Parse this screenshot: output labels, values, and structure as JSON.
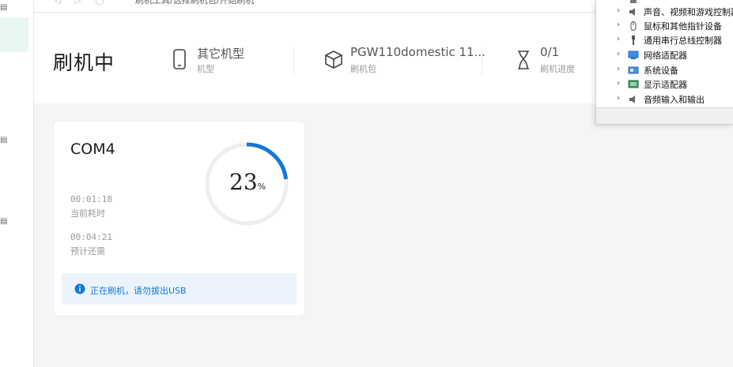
{
  "window": {
    "breadcrumb": "刷机工具/选择刷机包/开始刷机"
  },
  "header": {
    "title": "刷机中",
    "model": {
      "value": "其它机型",
      "label": "机型"
    },
    "package": {
      "value": "PGW110domestic 11...",
      "label": "刷机包"
    },
    "progress": {
      "value": "0/1",
      "label": "刷机进度"
    }
  },
  "card": {
    "port": "COM4",
    "elapsed": {
      "value": "00:01:18",
      "label": "当前耗时"
    },
    "remaining": {
      "value": "00:04:21",
      "label": "预计还需"
    },
    "percent_text": "23",
    "percent_unit": "%",
    "percent": 23,
    "notice": "正在刷机，请勿拔出USB"
  },
  "device_manager": {
    "items": [
      {
        "label": "声音、视频和游戏控制器",
        "icon": "speaker-icon"
      },
      {
        "label": "鼠标和其他指针设备",
        "icon": "mouse-icon"
      },
      {
        "label": "通用串行总线控制器",
        "icon": "usb-icon"
      },
      {
        "label": "网络适配器",
        "icon": "network-adapter-icon"
      },
      {
        "label": "系统设备",
        "icon": "system-device-icon"
      },
      {
        "label": "显示适配器",
        "icon": "display-adapter-icon"
      },
      {
        "label": "音频输入和输出",
        "icon": "audio-io-icon"
      }
    ]
  },
  "colors": {
    "accent": "#1677d2",
    "ring_track": "#eeeeee",
    "notice_bg": "#ebf4fd"
  }
}
